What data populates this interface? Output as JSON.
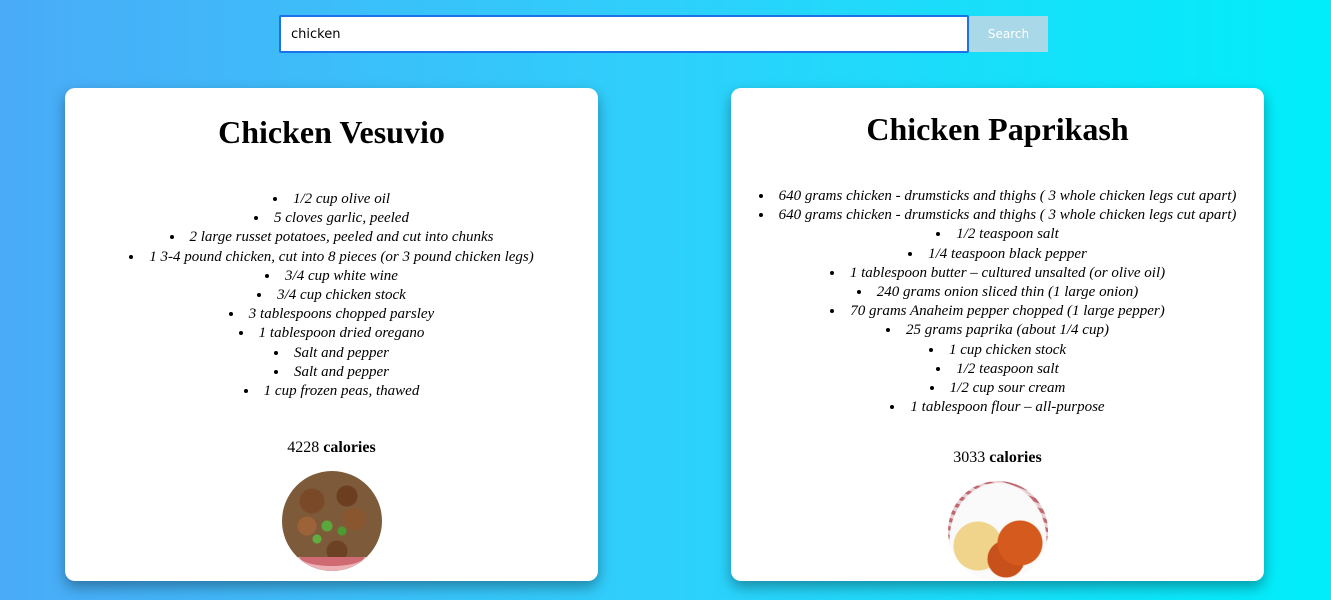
{
  "search": {
    "value": "chicken",
    "button_label": "Search"
  },
  "recipes": [
    {
      "title": "Chicken Vesuvio",
      "ingredients": [
        "1/2 cup olive oil",
        "5 cloves garlic, peeled",
        "2 large russet potatoes, peeled and cut into chunks",
        "1 3-4 pound chicken, cut into 8 pieces (or 3 pound chicken legs)",
        "3/4 cup white wine",
        "3/4 cup chicken stock",
        "3 tablespoons chopped parsley",
        "1 tablespoon dried oregano",
        "Salt and pepper",
        "Salt and pepper",
        "1 cup frozen peas, thawed"
      ],
      "calories_value": "4228",
      "calories_label": "calories"
    },
    {
      "title": "Chicken Paprikash",
      "ingredients": [
        "640 grams chicken - drumsticks and thighs ( 3 whole chicken legs cut apart)",
        "640 grams chicken - drumsticks and thighs ( 3 whole chicken legs cut apart)",
        "1/2 teaspoon salt",
        "1/4 teaspoon black pepper",
        "1 tablespoon butter – cultured unsalted (or olive oil)",
        "240 grams onion sliced thin (1 large onion)",
        "70 grams Anaheim pepper chopped (1 large pepper)",
        "25 grams paprika (about 1/4 cup)",
        "1 cup chicken stock",
        "1/2 teaspoon salt",
        "1/2 cup sour cream",
        "1 tablespoon flour – all-purpose"
      ],
      "calories_value": "3033",
      "calories_label": "calories"
    }
  ]
}
